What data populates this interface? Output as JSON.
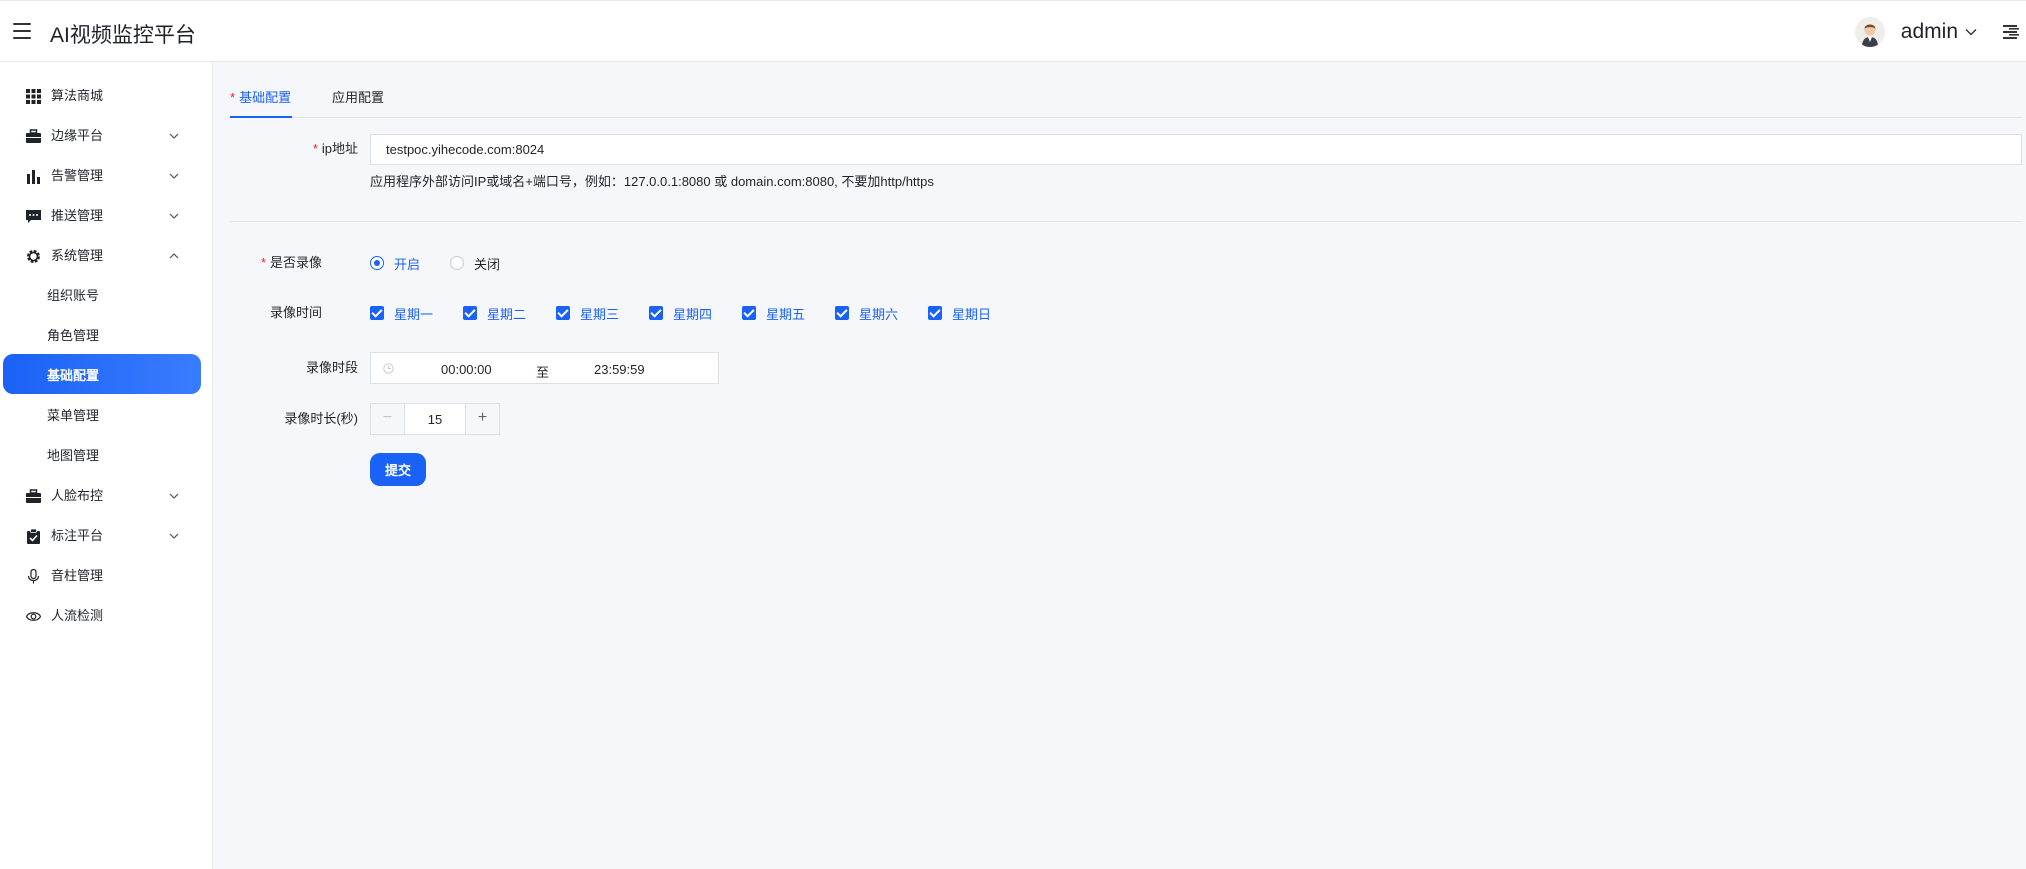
{
  "header": {
    "title": "AI视频监控平台",
    "username": "admin"
  },
  "sidebar": {
    "items": [
      {
        "label": "算法商城",
        "icon": "grid-icon"
      },
      {
        "label": "边缘平台",
        "icon": "briefcase-icon",
        "expandable": true
      },
      {
        "label": "告警管理",
        "icon": "bar-chart-icon",
        "expandable": true
      },
      {
        "label": "推送管理",
        "icon": "message-icon",
        "expandable": true
      },
      {
        "label": "系统管理",
        "icon": "gear-icon",
        "expanded": true
      },
      {
        "label": "人脸布控",
        "icon": "briefcase-icon",
        "expandable": true
      },
      {
        "label": "标注平台",
        "icon": "clipboard-check-icon",
        "expandable": true
      },
      {
        "label": "音柱管理",
        "icon": "microphone-icon"
      },
      {
        "label": "人流检测",
        "icon": "eye-icon"
      }
    ],
    "system_subitems": [
      {
        "label": "组织账号"
      },
      {
        "label": "角色管理"
      },
      {
        "label": "基础配置",
        "active": true
      },
      {
        "label": "菜单管理"
      },
      {
        "label": "地图管理"
      }
    ]
  },
  "tabs": [
    {
      "label": "基础配置",
      "required": "*",
      "active": true
    },
    {
      "label": "应用配置"
    }
  ],
  "form": {
    "ip": {
      "required": "*",
      "label": "ip地址",
      "value": "testpoc.yihecode.com:8024",
      "hint": "应用程序外部访问IP或域名+端口号，例如：127.0.0.1:8080 或 domain.com:8080, 不要加http/https"
    },
    "record": {
      "required": "*",
      "label": "是否录像",
      "options": [
        "开启",
        "关闭"
      ],
      "selected": "开启"
    },
    "record_days": {
      "label": "录像时间",
      "days": [
        "星期一",
        "星期二",
        "星期三",
        "星期四",
        "星期五",
        "星期六",
        "星期日"
      ],
      "checked": [
        true,
        true,
        true,
        true,
        true,
        true,
        true
      ]
    },
    "record_period": {
      "label": "录像时段",
      "start": "00:00:00",
      "separator": "至",
      "end": "23:59:59"
    },
    "record_duration": {
      "label": "录像时长(秒)",
      "value": "15",
      "minus": "−",
      "plus": "+"
    },
    "submit_label": "提交"
  },
  "colors": {
    "accent": "#1a62f5",
    "required": "#f5222d"
  }
}
